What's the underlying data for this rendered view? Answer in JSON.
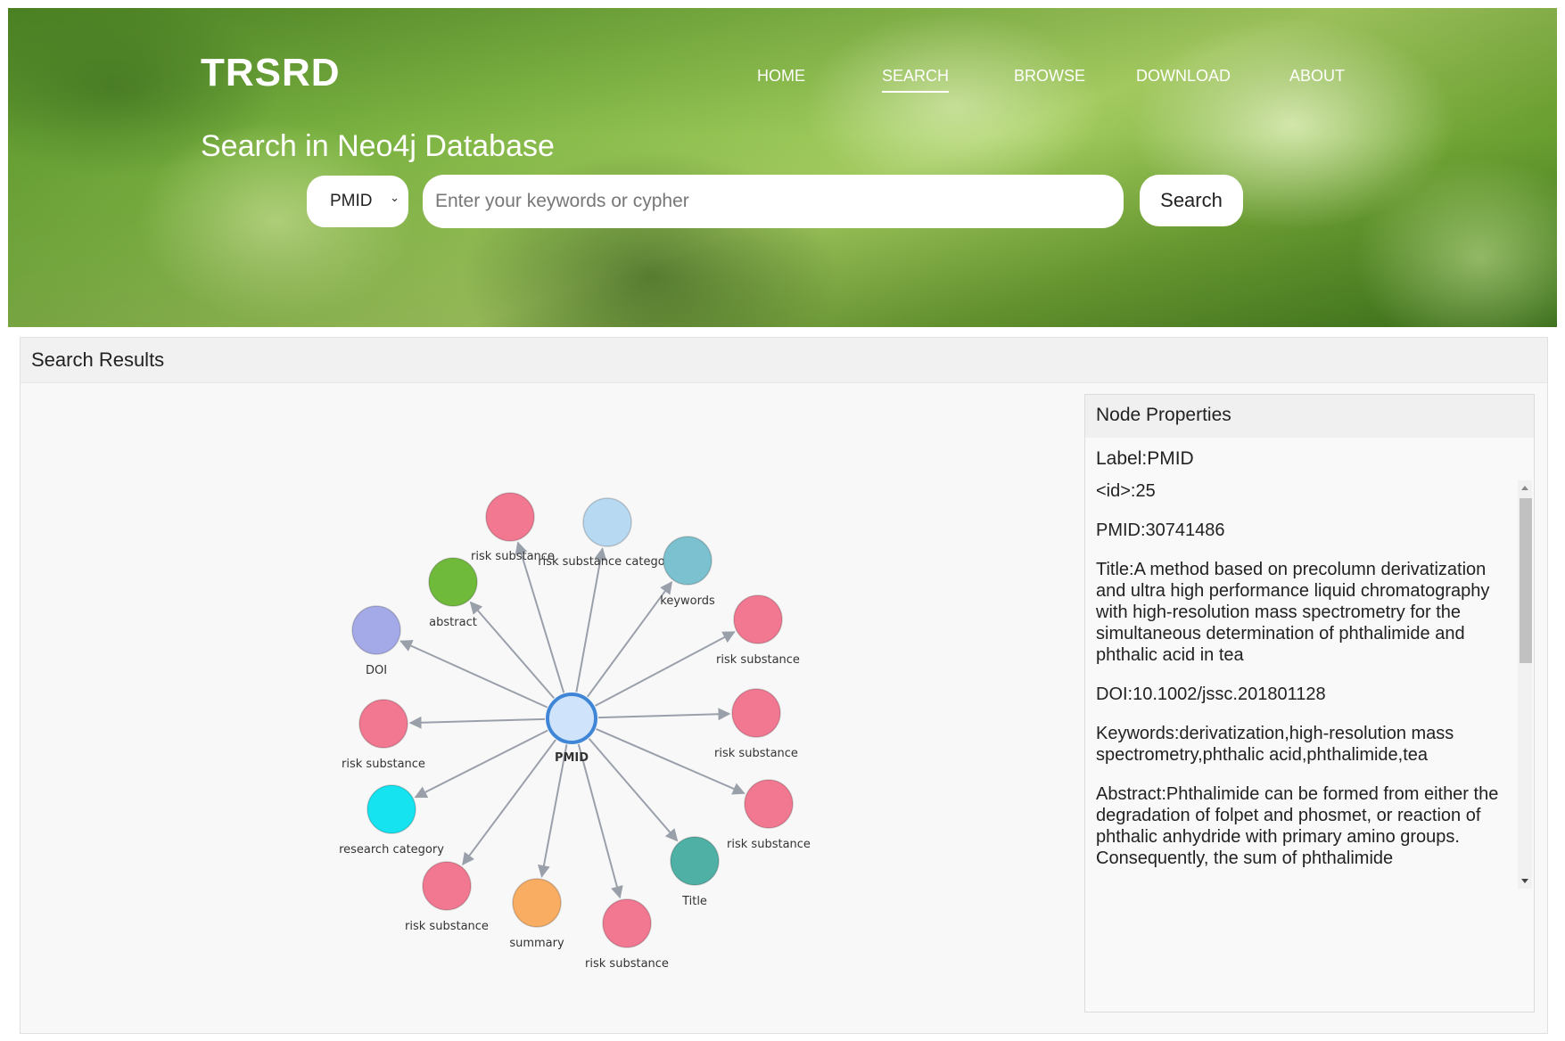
{
  "header": {
    "brand": "TRSRD",
    "nav": [
      "HOME",
      "SEARCH",
      "BROWSE",
      "DOWNLOAD",
      "ABOUT"
    ],
    "active_nav": "SEARCH",
    "subtitle": "Search in Neo4j Database"
  },
  "search": {
    "select_value": "PMID",
    "placeholder": "Enter your keywords or cypher",
    "button_label": "Search"
  },
  "results": {
    "title": "Search Results"
  },
  "graph": {
    "center": {
      "label": "PMID",
      "color": "#cfe4fa",
      "stroke": "#3f86d6"
    },
    "nodes": [
      {
        "label": "risk substance",
        "color": "#f27891"
      },
      {
        "label": "risk substance category",
        "color": "#b8d9f2"
      },
      {
        "label": "keywords",
        "color": "#7cc1cf"
      },
      {
        "label": "risk substance",
        "color": "#f27891"
      },
      {
        "label": "risk substance",
        "color": "#f27891"
      },
      {
        "label": "risk substance",
        "color": "#f27891"
      },
      {
        "label": "Title",
        "color": "#4fb0a5"
      },
      {
        "label": "risk substance",
        "color": "#f27891"
      },
      {
        "label": "summary",
        "color": "#f8ad63"
      },
      {
        "label": "risk substance",
        "color": "#f27891"
      },
      {
        "label": "research category",
        "color": "#16e3f0"
      },
      {
        "label": "risk substance",
        "color": "#f27891"
      },
      {
        "label": "DOI",
        "color": "#a4a9e8"
      },
      {
        "label": "abstract",
        "color": "#6fba3a"
      }
    ]
  },
  "properties": {
    "title": "Node Properties",
    "label": "Label:PMID",
    "fields": [
      "<id>:25",
      "PMID:30741486",
      "Title:A method based on precolumn derivatization and ultra high performance liquid chromatography with high-resolution mass spectrometry for the simultaneous determination of phthalimide and phthalic acid in tea",
      "DOI:10.1002/jssc.201801128",
      "Keywords:derivatization,high-resolution mass spectrometry,phthalic acid,phthalimide,tea",
      "Abstract:Phthalimide can be formed from either the degradation of folpet and phosmet, or reaction of phthalic anhydride with primary amino groups. Consequently, the sum of phthalimide"
    ]
  }
}
